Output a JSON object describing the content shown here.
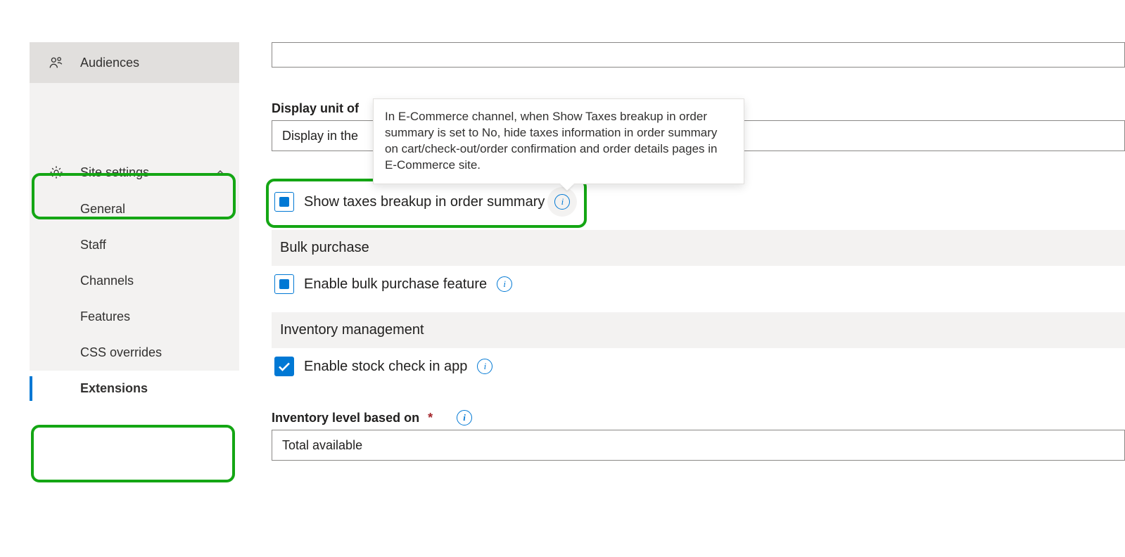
{
  "sidebar": {
    "top_item": {
      "label": "Audiences"
    },
    "section": {
      "label": "Site settings"
    },
    "subitems": [
      {
        "label": "General"
      },
      {
        "label": "Staff"
      },
      {
        "label": "Channels"
      },
      {
        "label": "Features"
      },
      {
        "label": "CSS overrides"
      },
      {
        "label": "Extensions"
      }
    ]
  },
  "main": {
    "display_unit_label": "Display unit of",
    "display_unit_value": "Display in the ",
    "show_taxes_label": "Show taxes breakup in order summary",
    "bulk_header": "Bulk purchase",
    "bulk_checkbox_label": "Enable bulk purchase feature",
    "inventory_header": "Inventory management",
    "stock_check_label": "Enable stock check in app",
    "inventory_level_label": "Inventory level based on",
    "inventory_level_value": "Total available"
  },
  "tooltip": {
    "text": "In E-Commerce channel, when Show Taxes breakup in order summary is set to No, hide taxes information in order summary on cart/check-out/order confirmation and order details pages in E-Commerce site."
  }
}
